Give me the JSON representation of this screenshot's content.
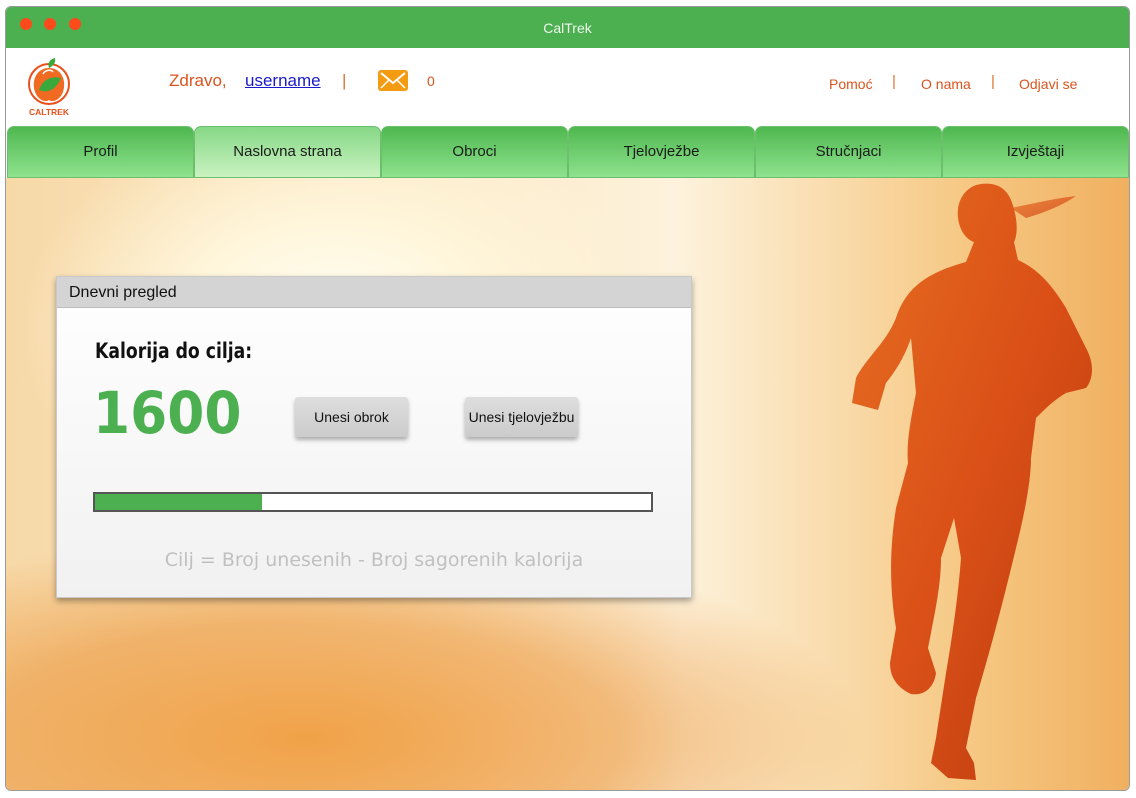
{
  "window": {
    "title": "CalTrek"
  },
  "header": {
    "logo_text": "CALTREK",
    "greeting": "Zdravo,",
    "username": "username",
    "separator": "|",
    "message_count": "0",
    "links": {
      "help": "Pomoć",
      "about": "O nama",
      "logout": "Odjavi se"
    }
  },
  "tabs": [
    {
      "label": "Profil"
    },
    {
      "label": "Naslovna strana"
    },
    {
      "label": "Obroci"
    },
    {
      "label": "Tjelovježbe"
    },
    {
      "label": "Stručnjaci"
    },
    {
      "label": "Izvještaji"
    }
  ],
  "active_tab": "Naslovna strana",
  "panel": {
    "title": "Dnevni pregled",
    "calories_label": "Kalorija do cilja:",
    "calories_value": "1600",
    "add_meal_button": "Unesi obrok",
    "add_exercise_button": "Unesi tjelovježbu",
    "progress_fraction": 0.3,
    "formula": "Cilj = Broj unesenih - Broj sagorenih kalorija"
  },
  "colors": {
    "brand_green": "#4caf50",
    "accent_orange": "#d9541e",
    "traffic_light": "#ff4a1c"
  },
  "icons": {
    "mail": "envelope-icon",
    "logo": "apple-leaf-icon"
  }
}
